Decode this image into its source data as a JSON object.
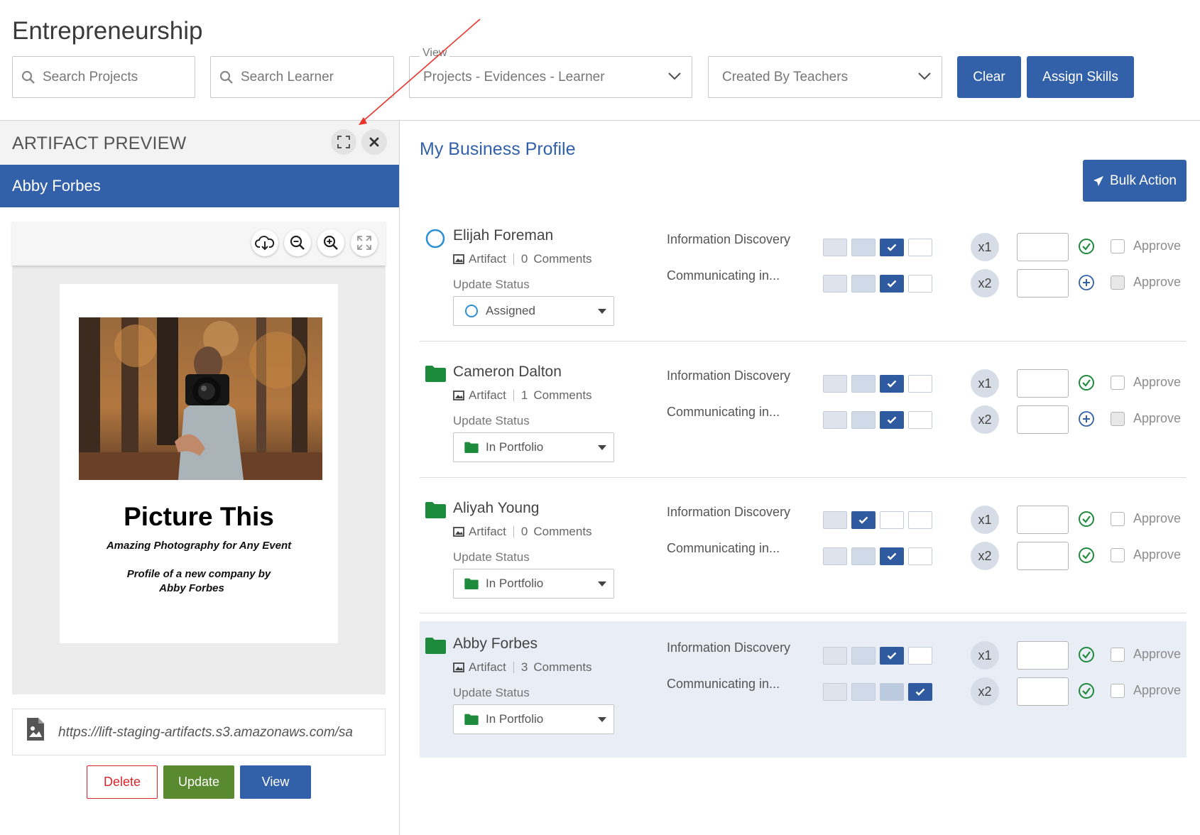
{
  "page": {
    "title": "Entrepreneurship"
  },
  "filters": {
    "search_projects": {
      "placeholder": "Search Projects"
    },
    "search_learner": {
      "placeholder": "Search Learner"
    },
    "view": {
      "legend": "View",
      "value": "Projects - Evidences - Learner"
    },
    "created_by": {
      "value": "Created By Teachers"
    },
    "clear_label": "Clear",
    "assign_label": "Assign Skills"
  },
  "preview": {
    "title": "ARTIFACT PREVIEW",
    "learner": "Abby Forbes",
    "doc": {
      "title": "Picture This",
      "subtitle": "Amazing Photography for Any Event",
      "profile_line1": "Profile of a new company by",
      "profile_line2": "Abby Forbes"
    },
    "url": "https://lift-staging-artifacts.s3.amazonaws.com/sa",
    "delete_label": "Delete",
    "update_label": "Update",
    "view_label": "View"
  },
  "main": {
    "section_title": "My Business Profile",
    "bulk_action_label": "Bulk Action",
    "update_status_label": "Update Status",
    "approve_label": "Approve",
    "artifact_label": "Artifact",
    "comments_label": "Comments",
    "rows": [
      {
        "name": "Elijah Foreman",
        "comment_count": "0",
        "status": "Assigned",
        "status_icon": "circle-outline-icon",
        "skills": [
          {
            "label": "Information Discovery",
            "level": 3,
            "multiplier": "x1",
            "status_icon": "check-circle-icon"
          },
          {
            "label": "Communicating in...",
            "level": 3,
            "multiplier": "x2",
            "status_icon": "plus-circle-icon"
          }
        ]
      },
      {
        "name": "Cameron Dalton",
        "comment_count": "1",
        "status": "In Portfolio",
        "status_icon": "folder-icon",
        "skills": [
          {
            "label": "Information Discovery",
            "level": 3,
            "multiplier": "x1",
            "status_icon": "check-circle-icon"
          },
          {
            "label": "Communicating in...",
            "level": 3,
            "multiplier": "x2",
            "status_icon": "plus-circle-icon"
          }
        ]
      },
      {
        "name": "Aliyah Young",
        "comment_count": "0",
        "status": "In Portfolio",
        "status_icon": "folder-icon",
        "skills": [
          {
            "label": "Information Discovery",
            "level": 2,
            "multiplier": "x1",
            "status_icon": "check-circle-icon"
          },
          {
            "label": "Communicating in...",
            "level": 3,
            "multiplier": "x2",
            "status_icon": "check-circle-icon"
          }
        ]
      },
      {
        "name": "Abby Forbes",
        "comment_count": "3",
        "status": "In Portfolio",
        "status_icon": "folder-icon",
        "highlighted": true,
        "skills": [
          {
            "label": "Information Discovery",
            "level": 3,
            "multiplier": "x1",
            "status_icon": "check-circle-icon"
          },
          {
            "label": "Communicating in...",
            "level": 4,
            "multiplier": "x2",
            "status_icon": "check-circle-icon"
          }
        ]
      }
    ]
  },
  "colors": {
    "primary": "#3361a9",
    "success_green": "#5a8a30",
    "danger_red": "#d9262b",
    "folder_green": "#1e8a3c",
    "status_blue": "#2d8fd5",
    "arrow_red": "#e8342a"
  }
}
